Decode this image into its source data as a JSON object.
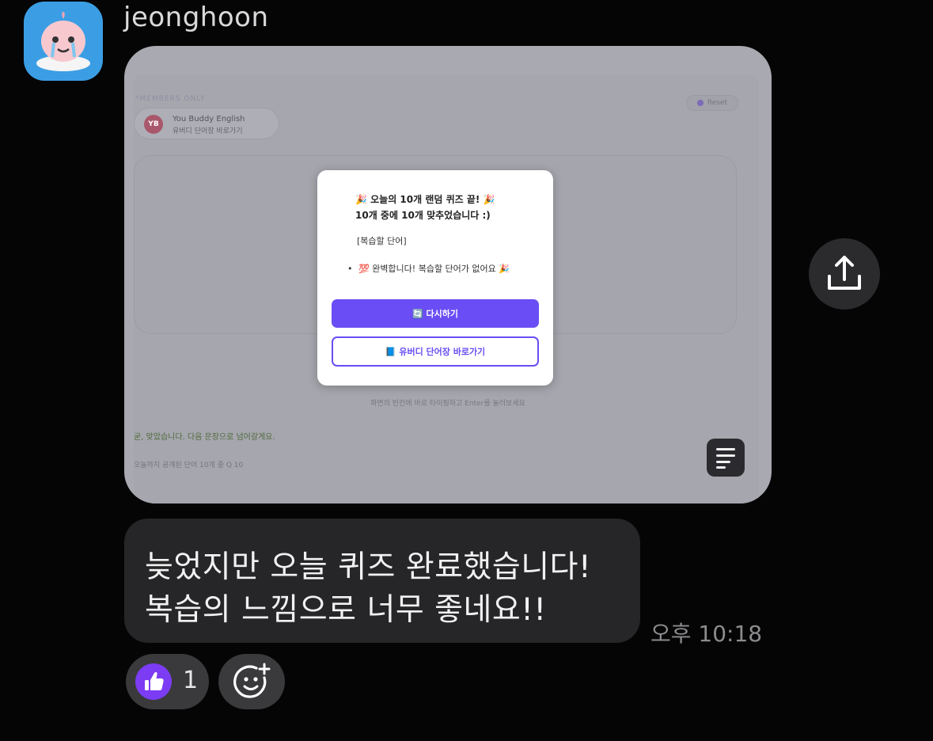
{
  "sender": {
    "name": "jeonghoon"
  },
  "shared_screenshot": {
    "members_label": "*MEMBERS ONLY",
    "chip_title": "You Buddy English",
    "chip_subtitle": "유버디 단어장 바로가기",
    "chip_badge": "YB",
    "reset_label": "Reset",
    "hint_text": "화면의 빈칸에 바로 타이핑하고 Enter를 눌러보세요",
    "correct_text": "굳, 맞았습니다. 다음 문장으로 넘어갈게요.",
    "progress_text": "오늘까지 공개된 단어 10개 중 Q 10",
    "modal": {
      "title_line1": "🎉 오늘의 10개 랜덤 퀴즈 끝! 🎉",
      "title_line2": "10개 중에 10개 맞추었습니다 :)",
      "review_label": "[복습할 단어]",
      "bullet_text": "💯 완벽합니다! 복습할 단어가 없어요 🎉",
      "retry_button": "🔄 다시하기",
      "vocab_button": "📘 유버디 단어장 바로가기"
    }
  },
  "message": {
    "line1": "늦었지만 오늘 퀴즈 완료했습니다!",
    "line2": "복습의 느낌으로 너무 좋네요!!",
    "time": "오후 10:18"
  },
  "reaction": {
    "icon": "thumbs-up-icon",
    "count": "1"
  },
  "colors": {
    "accent": "#6a4df4",
    "reaction": "#7c3cf3",
    "bubble": "#262628"
  }
}
